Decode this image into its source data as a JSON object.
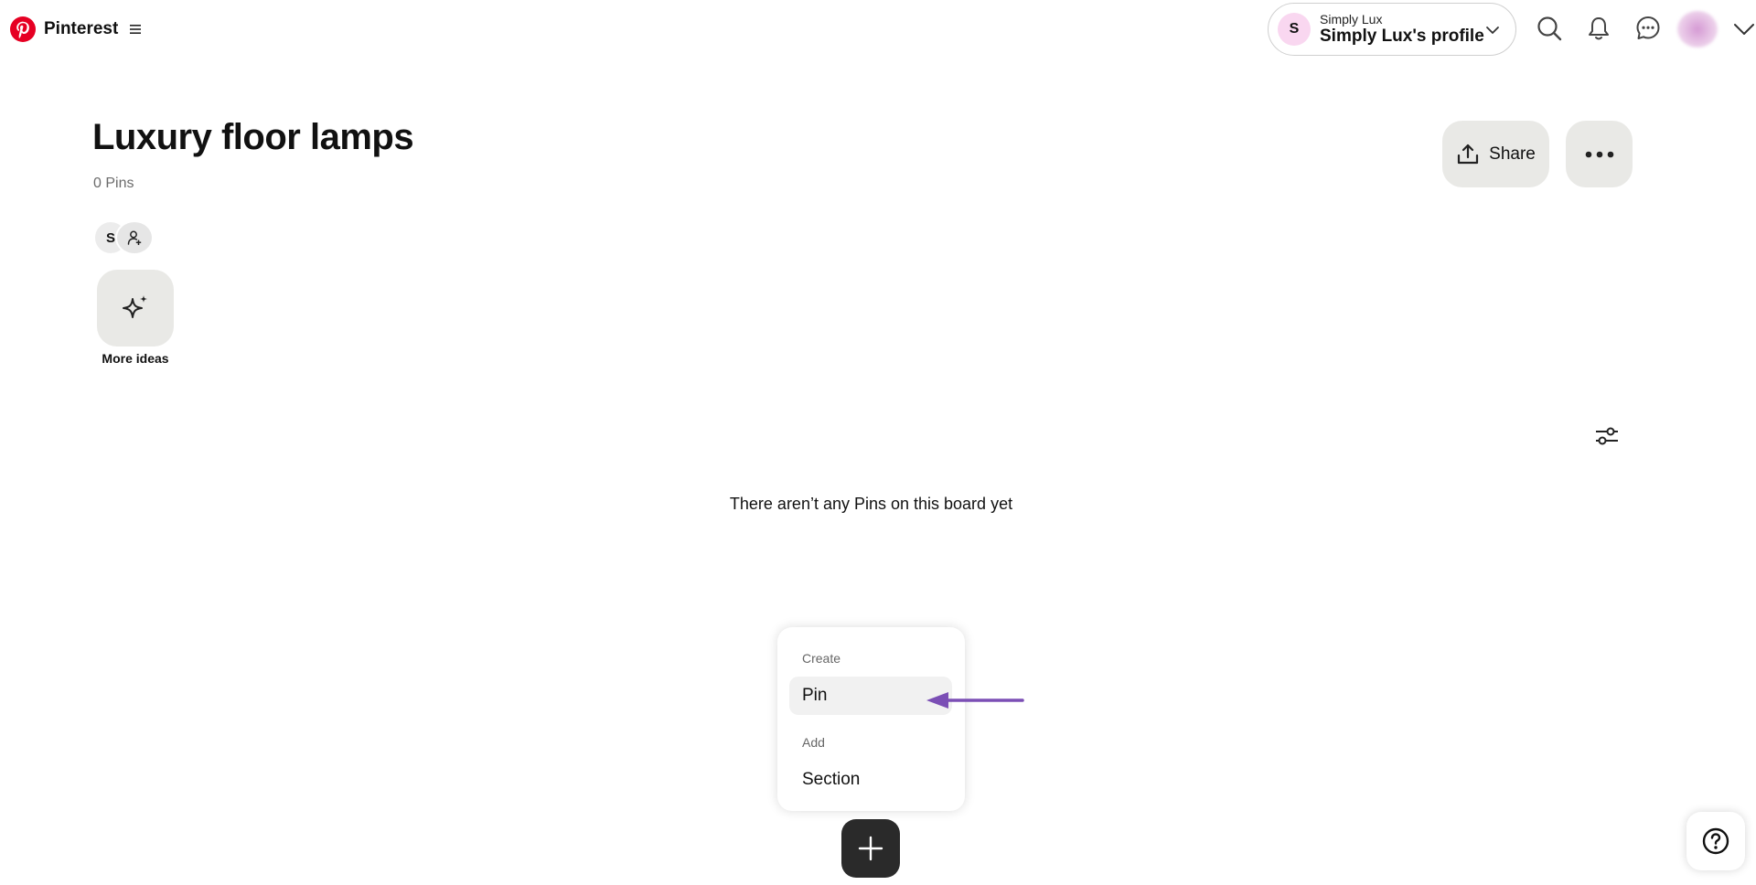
{
  "header": {
    "brand_name": "Pinterest",
    "profile": {
      "avatar_letter": "S",
      "account_name": "Simply Lux",
      "profile_label": "Simply Lux's profile"
    },
    "icons": [
      "search-icon",
      "bell-icon",
      "messages-icon",
      "user-avatar",
      "chevron-down-icon"
    ]
  },
  "board": {
    "title": "Luxury floor lamps",
    "pin_count": "0 Pins",
    "collaborator_initial": "S",
    "more_ideas_label": "More ideas",
    "share_label": "Share",
    "empty_message": "There aren’t any Pins on this board yet"
  },
  "create_menu": {
    "create_heading": "Create",
    "pin_label": "Pin",
    "add_heading": "Add",
    "section_label": "Section"
  },
  "colors": {
    "brand_red": "#E60023",
    "button_bg": "#E9E9E6",
    "annotation_arrow": "#7B4FB5",
    "fab_bg": "#2A2A2A",
    "avatar_pink": "#F9D7F0"
  }
}
